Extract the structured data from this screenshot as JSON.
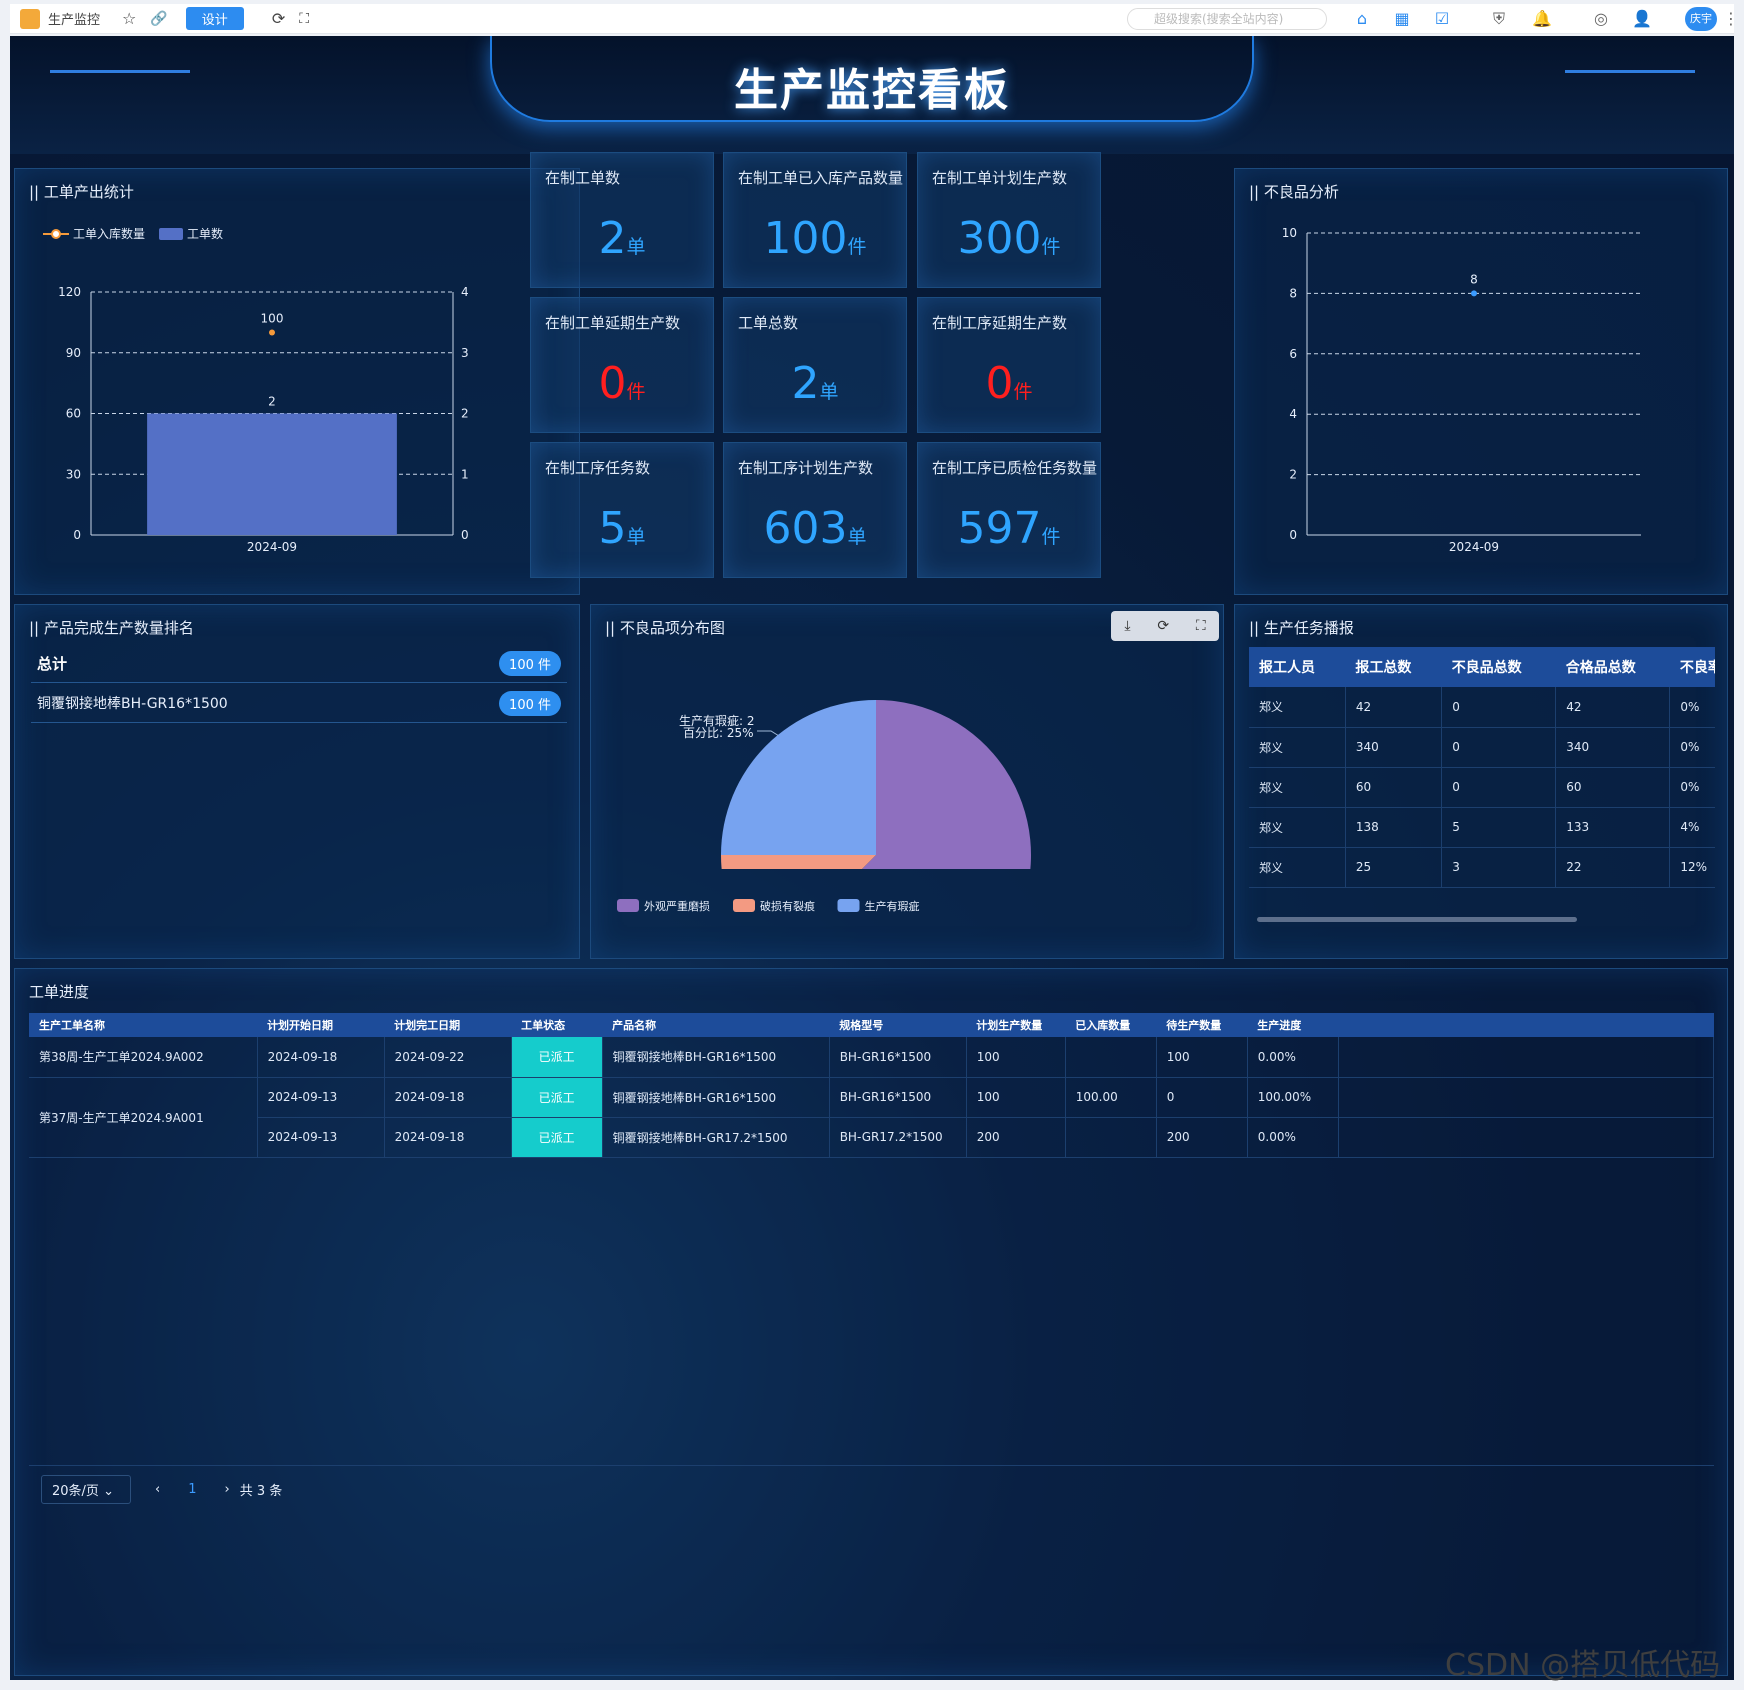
{
  "browser": {
    "tab_title": "生产监控",
    "design_btn": "设计",
    "search_placeholder": "超级搜索(搜索全站内容)",
    "user": "庆宇"
  },
  "dashboard": {
    "title": "生产监控看板"
  },
  "output_panel": {
    "title": "|| 工单产出统计",
    "legend_line": "工单入库数量",
    "legend_bar": "工单数"
  },
  "kpis": [
    {
      "label": "在制工单数",
      "value": "2",
      "unit": "单",
      "color": "#2fa5ff"
    },
    {
      "label": "在制工单已入库产品数量",
      "value": "100",
      "unit": "件",
      "color": "#2fa5ff"
    },
    {
      "label": "在制工单计划生产数",
      "value": "300",
      "unit": "件",
      "color": "#2fa5ff"
    },
    {
      "label": "在制工单延期生产数",
      "value": "0",
      "unit": "件",
      "color": "#ff1f1f"
    },
    {
      "label": "工单总数",
      "value": "2",
      "unit": "单",
      "color": "#2fa5ff"
    },
    {
      "label": "在制工序延期生产数",
      "value": "0",
      "unit": "件",
      "color": "#ff1f1f"
    },
    {
      "label": "在制工序任务数",
      "value": "5",
      "unit": "单",
      "color": "#2fa5ff"
    },
    {
      "label": "在制工序计划生产数",
      "value": "603",
      "unit": "单",
      "color": "#2fa5ff"
    },
    {
      "label": "在制工序已质检任务数量",
      "value": "597",
      "unit": "件",
      "color": "#2fa5ff"
    }
  ],
  "defect_panel": {
    "title": "|| 不良品分析"
  },
  "ranking_panel": {
    "title": "|| 产品完成生产数量排名",
    "total_label": "总计",
    "total_value": "100 件",
    "items": [
      {
        "name": "铜覆钢接地棒BH-GR16*1500",
        "value": "100 件"
      }
    ]
  },
  "dist_panel": {
    "title": "|| 不良品项分布图",
    "pie_label_line1": "生产有瑕疵: 2",
    "pie_label_line2": "百分比: 25%",
    "legend": [
      "外观严重磨损",
      "破损有裂痕",
      "生产有瑕疵"
    ]
  },
  "task_panel": {
    "title": "|| 生产任务播报",
    "headers": [
      "报工人员",
      "报工总数",
      "不良品总数",
      "合格品总数",
      "不良率"
    ],
    "rows": [
      [
        "郑义",
        "42",
        "0",
        "42",
        "0%"
      ],
      [
        "郑义",
        "340",
        "0",
        "340",
        "0%"
      ],
      [
        "郑义",
        "60",
        "0",
        "60",
        "0%"
      ],
      [
        "郑义",
        "138",
        "5",
        "133",
        "4%"
      ],
      [
        "郑义",
        "25",
        "3",
        "22",
        "12%"
      ]
    ]
  },
  "progress_panel": {
    "title": "工单进度",
    "headers": [
      "生产工单名称",
      "计划开始日期",
      "计划完工日期",
      "工单状态",
      "产品名称",
      "规格型号",
      "计划生产数量",
      "已入库数量",
      "待生产数量",
      "生产进度"
    ],
    "orders": [
      {
        "name": "第38周-生产工单2024.9A002",
        "lines": [
          [
            "2024-09-18",
            "2024-09-22",
            "已派工",
            "铜覆钢接地棒BH-GR16*1500",
            "BH-GR16*1500",
            "100",
            "",
            "100",
            "0.00%"
          ]
        ]
      },
      {
        "name": "第37周-生产工单2024.9A001",
        "lines": [
          [
            "2024-09-13",
            "2024-09-18",
            "已派工",
            "铜覆钢接地棒BH-GR16*1500",
            "BH-GR16*1500",
            "100",
            "100.00",
            "0",
            "100.00%"
          ],
          [
            "2024-09-13",
            "2024-09-18",
            "已派工",
            "铜覆钢接地棒BH-GR17.2*1500",
            "BH-GR17.2*1500",
            "200",
            "",
            "200",
            "0.00%"
          ]
        ]
      }
    ],
    "page_size": "20条/页",
    "current_page": "1",
    "total": "共 3 条"
  },
  "watermark": "CSDN @搭贝低代码",
  "chart_data": [
    {
      "type": "bar",
      "categories": [
        "2024-09"
      ],
      "series": [
        {
          "name": "工单数",
          "values": [
            2
          ],
          "axis": "right",
          "color": "#5470c6"
        },
        {
          "name": "工单入库数量",
          "values": [
            100
          ],
          "axis": "left",
          "kind": "line",
          "color": "#f59a3b"
        }
      ],
      "ylim_left": [
        0,
        120
      ],
      "yticks_left": [
        0,
        30,
        60,
        90,
        120
      ],
      "ylim_right": [
        0,
        4
      ],
      "yticks_right": [
        0,
        1,
        2,
        3,
        4
      ],
      "grid": true,
      "legend_position": "top-left"
    },
    {
      "type": "scatter",
      "categories": [
        "2024-09"
      ],
      "values": [
        8
      ],
      "ylim": [
        0,
        10
      ],
      "yticks": [
        0,
        2,
        4,
        6,
        8,
        10
      ],
      "grid": true,
      "color": "#3b9bff"
    },
    {
      "type": "pie",
      "labels": [
        "外观严重磨损",
        "破损有裂痕",
        "生产有瑕疵"
      ],
      "values": [
        5,
        1,
        2
      ],
      "colors": [
        "#8e6fbf",
        "#f39a82",
        "#77a3f0"
      ]
    }
  ]
}
